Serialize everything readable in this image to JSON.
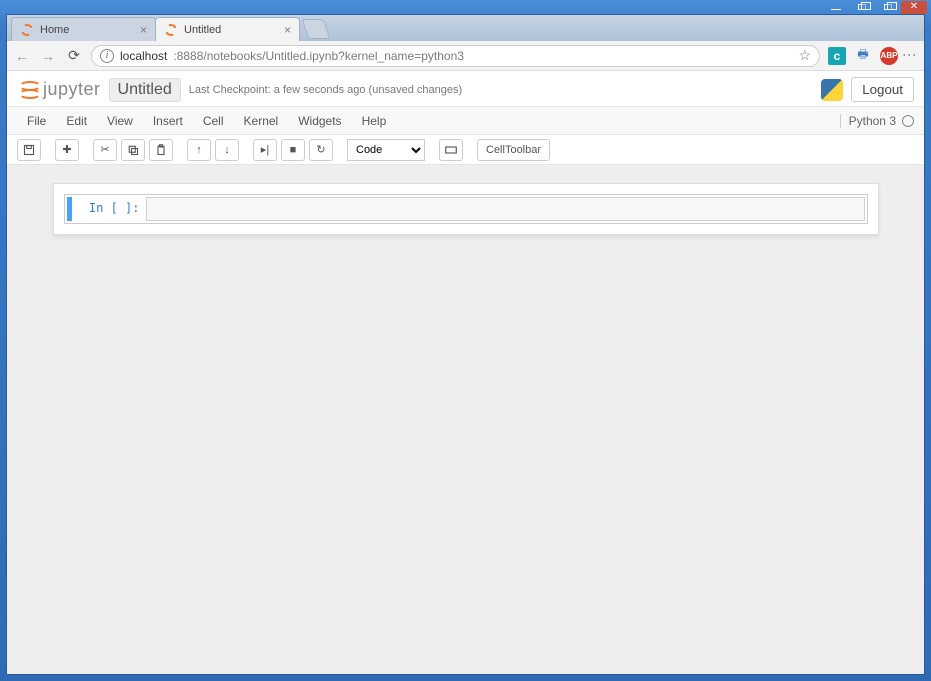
{
  "window": {
    "tabs": [
      {
        "title": "Home",
        "active": false
      },
      {
        "title": "Untitled",
        "active": true
      }
    ]
  },
  "address": {
    "host": "localhost",
    "port_path": ":8888/notebooks/Untitled.ipynb?kernel_name=python3"
  },
  "header": {
    "brand": "jupyter",
    "notebook_name": "Untitled",
    "checkpoint": "Last Checkpoint: a few seconds ago (unsaved changes)",
    "logout": "Logout"
  },
  "menus": {
    "file": "File",
    "edit": "Edit",
    "view": "View",
    "insert": "Insert",
    "cell": "Cell",
    "kernel": "Kernel",
    "widgets": "Widgets",
    "help": "Help",
    "kernel_name": "Python 3"
  },
  "toolbar": {
    "celltype_selected": "Code",
    "celltoolbar": "CellToolbar"
  },
  "notebook": {
    "cell0_prompt": "In [ ]:"
  }
}
